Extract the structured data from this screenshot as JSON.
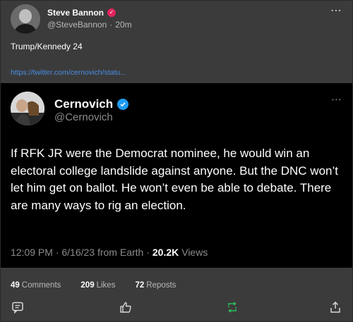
{
  "post": {
    "author": "Steve Bannon",
    "handle": "@SteveBannon",
    "separator": "·",
    "time": "20m",
    "text": "Trump/Kennedy 24",
    "link": "https://twitter.com/cernovich/statu...",
    "more": "⋯"
  },
  "quote": {
    "author": "Cernovich",
    "handle": "@Cernovich",
    "more": "⋯",
    "body": "If RFK JR were the Democrat nominee, he would win an electoral college landslide against anyone. But the DNC won’t let him get on ballot. He won’t even be able to debate. There are many ways to rig an election.",
    "time": "12:09 PM · 6/16/23 from Earth ·",
    "views_count": "20.2K",
    "views_label": "Views"
  },
  "stats": {
    "comments_count": "49",
    "comments_label": "Comments",
    "likes_count": "209",
    "likes_label": "Likes",
    "reposts_count": "72",
    "reposts_label": "Reposts"
  },
  "icons": {
    "comment": "comment-icon",
    "like": "thumbs-up-icon",
    "repost": "repost-icon",
    "share": "share-icon"
  },
  "colors": {
    "repost_active": "#2bbf5b",
    "link": "#4a8ee6",
    "verified_blue": "#1d9bf0",
    "verified_red": "#e0245e"
  }
}
